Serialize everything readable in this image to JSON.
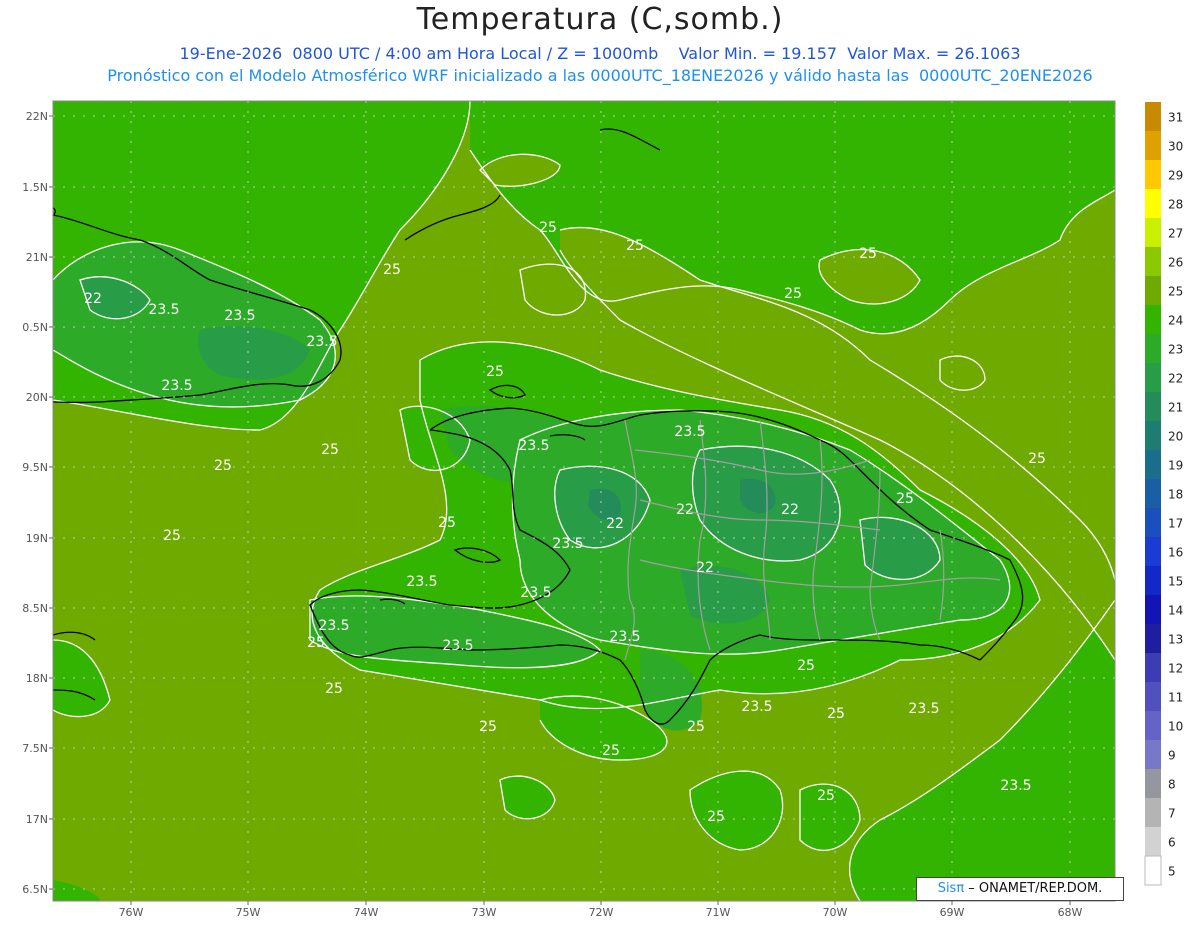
{
  "header": {
    "title": "Temperatura (C,somb.)",
    "line1": "19-Ene-2026  0800 UTC / 4:00 am Hora Local / Z = 1000mb    Valor Min. = 19.157  Valor Max. = 26.1063",
    "line2": "Pronóstico con el Modelo Atmosférico WRF inicializado a las 0000UTC_18ENE2026 y válido hasta las  0000UTC_20ENE2026"
  },
  "axes": {
    "lat_labels": [
      "22N",
      "1.5N",
      "21N",
      "0.5N",
      "20N",
      "9.5N",
      "19N",
      "8.5N",
      "18N",
      "7.5N",
      "17N",
      "6.5N"
    ],
    "lon_labels": [
      "76W",
      "75W",
      "74W",
      "73W",
      "72W",
      "71W",
      "70W",
      "69W",
      "68W"
    ]
  },
  "colorbar": {
    "labels": [
      "31",
      "30",
      "29",
      "28",
      "27",
      "26",
      "25",
      "24",
      "23",
      "22",
      "21",
      "20",
      "19",
      "18",
      "17",
      "16",
      "15",
      "14",
      "13",
      "12",
      "11",
      "10",
      "9",
      "8",
      "7",
      "6",
      "5"
    ],
    "colors": [
      "#c88a00",
      "#e0a000",
      "#ffc800",
      "#ffff00",
      "#c8f000",
      "#8cc800",
      "#6eaa00",
      "#32b400",
      "#2daa28",
      "#289c46",
      "#238c5a",
      "#1e7d73",
      "#1a6e8c",
      "#1a5fa5",
      "#1a50be",
      "#1a3cd2",
      "#1428c8",
      "#1414b4",
      "#1e1ea0",
      "#3c3cb4",
      "#5050be",
      "#6464c8",
      "#7878c8",
      "#9696a0",
      "#b4b4b4",
      "#d2d2d2",
      "#ffffff"
    ]
  },
  "contour_labels": [
    "25",
    "25",
    "25",
    "25",
    "25",
    "22",
    "23.5",
    "23.5",
    "23.5",
    "23.5",
    "25",
    "25",
    "25",
    "25",
    "23.5",
    "23.5",
    "22",
    "22",
    "22",
    "22",
    "23.5",
    "25",
    "25",
    "25",
    "23.5",
    "23.5",
    "23.5",
    "23.5",
    "23.5",
    "25",
    "25",
    "25",
    "25",
    "25",
    "23.5",
    "25",
    "25",
    "23.5",
    "25",
    "25",
    "23.5"
  ],
  "credit": {
    "sis": "Sisπ",
    "org": " – ONAMET/REP.DOM."
  }
}
